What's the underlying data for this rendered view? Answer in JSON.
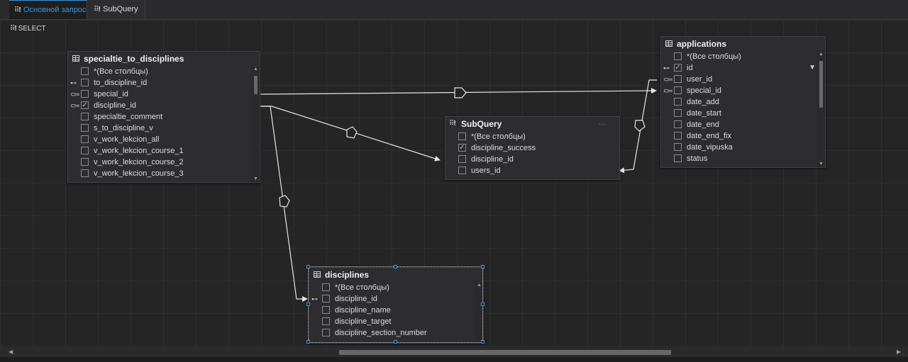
{
  "tabs": [
    {
      "label": "Основной запрос",
      "active": true
    },
    {
      "label": "SubQuery",
      "active": false
    }
  ],
  "canvas": {
    "select_label": "SELECT"
  },
  "tables": {
    "specialtie_to_disciplines": {
      "title": "specialtie_to_disciplines",
      "rows": [
        {
          "label": "*(Все столбцы)",
          "checked": false,
          "key": ""
        },
        {
          "label": "to_discipline_id",
          "checked": false,
          "key": "primary"
        },
        {
          "label": "special_id",
          "checked": false,
          "key": "foreign"
        },
        {
          "label": "discipline_id",
          "checked": true,
          "key": "foreign"
        },
        {
          "label": "specialtie_comment",
          "checked": false,
          "key": ""
        },
        {
          "label": "s_to_discipline_v",
          "checked": false,
          "key": ""
        },
        {
          "label": "v_work_lekcion_all",
          "checked": false,
          "key": ""
        },
        {
          "label": "v_work_lekcion_course_1",
          "checked": false,
          "key": ""
        },
        {
          "label": "v_work_lekcion_course_2",
          "checked": false,
          "key": ""
        },
        {
          "label": "v_work_lekcion_course_3",
          "checked": false,
          "key": ""
        }
      ]
    },
    "subquery": {
      "title": "SubQuery",
      "rows": [
        {
          "label": "*(Все столбцы)",
          "checked": false,
          "key": ""
        },
        {
          "label": "discipline_success",
          "checked": true,
          "key": ""
        },
        {
          "label": "discipline_id",
          "checked": false,
          "key": ""
        },
        {
          "label": "users_id",
          "checked": false,
          "key": ""
        }
      ]
    },
    "applications": {
      "title": "applications",
      "rows": [
        {
          "label": "*(Все столбцы)",
          "checked": false,
          "key": ""
        },
        {
          "label": "id",
          "checked": true,
          "key": "primary",
          "filter": true
        },
        {
          "label": "user_id",
          "checked": false,
          "key": "foreign"
        },
        {
          "label": "special_id",
          "checked": false,
          "key": "foreign"
        },
        {
          "label": "date_add",
          "checked": false,
          "key": ""
        },
        {
          "label": "date_start",
          "checked": false,
          "key": ""
        },
        {
          "label": "date_end",
          "checked": false,
          "key": ""
        },
        {
          "label": "date_end_fix",
          "checked": false,
          "key": ""
        },
        {
          "label": "date_vipuska",
          "checked": false,
          "key": ""
        },
        {
          "label": "status",
          "checked": false,
          "key": ""
        }
      ]
    },
    "disciplines": {
      "title": "disciplines",
      "selected": true,
      "rows": [
        {
          "label": "*(Все столбцы)",
          "checked": false,
          "key": ""
        },
        {
          "label": "discipline_id",
          "checked": false,
          "key": "primary"
        },
        {
          "label": "discipline_name",
          "checked": false,
          "key": ""
        },
        {
          "label": "discipline_target",
          "checked": false,
          "key": ""
        },
        {
          "label": "discipline_section_number",
          "checked": false,
          "key": ""
        }
      ]
    }
  },
  "colors": {
    "background": "#252526",
    "grid": "#2f2f31",
    "panel": "#2d2d30",
    "accent": "#3a96dd",
    "link": "#e6e6e6"
  }
}
